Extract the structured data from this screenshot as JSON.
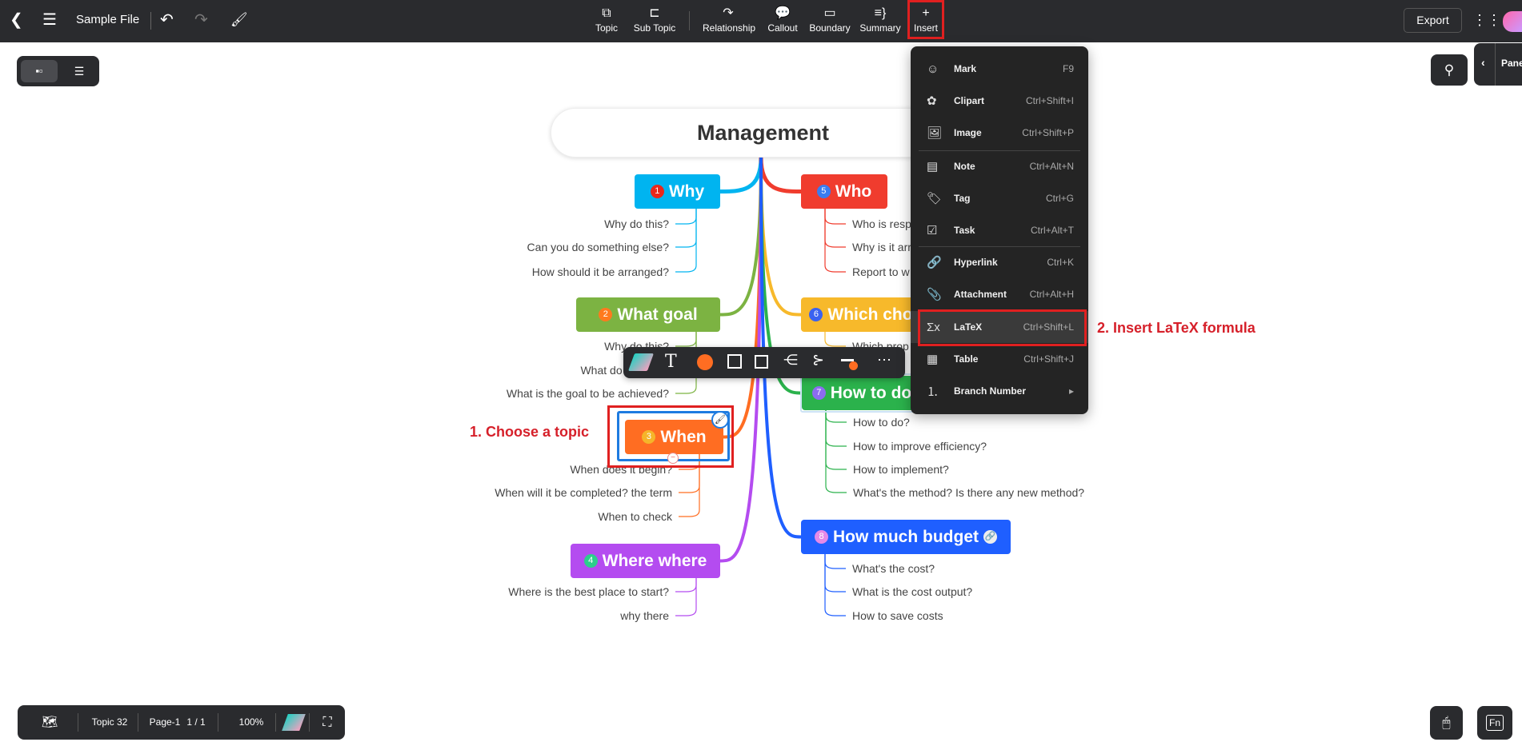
{
  "topbar": {
    "title": "Sample File",
    "tools": [
      {
        "label": "Topic",
        "icon": "topic-icon",
        "g": "⧉"
      },
      {
        "label": "Sub Topic",
        "icon": "subtopic-icon",
        "g": "⊏"
      },
      {
        "label": "Relationship",
        "icon": "relationship-icon",
        "g": "↷"
      },
      {
        "label": "Callout",
        "icon": "callout-icon",
        "g": "💬"
      },
      {
        "label": "Boundary",
        "icon": "boundary-icon",
        "g": "▭"
      },
      {
        "label": "Summary",
        "icon": "summary-icon",
        "g": "≡}"
      },
      {
        "label": "Insert",
        "icon": "plus-icon",
        "g": "+"
      }
    ],
    "export_label": "Export"
  },
  "panel": {
    "label": "Pane"
  },
  "mindmap": {
    "root": "Management",
    "branches": [
      {
        "num": "1",
        "label": "Why",
        "color": "#00b4f0",
        "numColor": "#e8271c",
        "leaves": [
          "Why do this?",
          "Can you do something else?",
          "How should it be arranged?"
        ]
      },
      {
        "num": "2",
        "label": "What goal",
        "color": "#7cb342",
        "numColor": "#ff7a1e",
        "leaves": [
          "Why do this?",
          "What do I need to",
          "What is the goal to be achieved?"
        ]
      },
      {
        "num": "3",
        "label": "When",
        "color": "#ff6d22",
        "numColor": "#f5b52a",
        "leaves": [
          "When does it begin?",
          "When will it be completed? the term",
          "When to check"
        ]
      },
      {
        "num": "4",
        "label": "Where where",
        "color": "#b44cf0",
        "numColor": "#2ccf8c",
        "leaves": [
          "Where is the best place to start?",
          "why there"
        ]
      },
      {
        "num": "5",
        "label": "Who",
        "color": "#f03c2e",
        "numColor": "#3a7cf0",
        "leaves": [
          "Who is resp",
          "Why is it arr",
          "Report to w"
        ]
      },
      {
        "num": "6",
        "label": "Which cho",
        "color": "#f7b92b",
        "numColor": "#3a62f0",
        "leaves": [
          "Which prop"
        ]
      },
      {
        "num": "7",
        "label": "How to do",
        "color": "#2bb24c",
        "numColor": "#8c6cf0",
        "leaves": [
          "How to do?",
          "How to improve efficiency?",
          "How to implement?",
          "What's the method? Is there any new method?"
        ]
      },
      {
        "num": "8",
        "label": "How much budget",
        "color": "#1f5fff",
        "numColor": "#e58ae8",
        "leaves": [
          "What's the cost?",
          "What is the cost output?",
          "How to save costs"
        ]
      }
    ]
  },
  "insert_menu": [
    {
      "label": "Mark",
      "shortcut": "F9",
      "icon": "mark-icon",
      "g": "☺"
    },
    {
      "label": "Clipart",
      "shortcut": "Ctrl+Shift+I",
      "icon": "clipart-icon",
      "g": "✿"
    },
    {
      "label": "Image",
      "shortcut": "Ctrl+Shift+P",
      "icon": "image-icon",
      "g": "🖼"
    },
    {
      "label": "Note",
      "shortcut": "Ctrl+Alt+N",
      "icon": "note-icon",
      "g": "▤"
    },
    {
      "label": "Tag",
      "shortcut": "Ctrl+G",
      "icon": "tag-icon",
      "g": "🏷"
    },
    {
      "label": "Task",
      "shortcut": "Ctrl+Alt+T",
      "icon": "task-icon",
      "g": "☑"
    },
    {
      "label": "Hyperlink",
      "shortcut": "Ctrl+K",
      "icon": "link-icon",
      "g": "🔗"
    },
    {
      "label": "Attachment",
      "shortcut": "Ctrl+Alt+H",
      "icon": "paperclip-icon",
      "g": "📎"
    },
    {
      "label": "LaTeX",
      "shortcut": "Ctrl+Shift+L",
      "icon": "sigma-icon",
      "g": "Σx"
    },
    {
      "label": "Table",
      "shortcut": "Ctrl+Shift+J",
      "icon": "table-icon",
      "g": "▦"
    },
    {
      "label": "Branch Number",
      "shortcut": "▸",
      "icon": "numbered-list-icon",
      "g": "⒈"
    }
  ],
  "annotations": {
    "step1": "1. Choose a topic",
    "step2": "2. Insert LaTeX formula"
  },
  "bottombar": {
    "topic_count": "Topic 32",
    "page": "Page-1",
    "page_count": "1 / 1",
    "zoom": "100%"
  },
  "colors": {
    "accent_red": "#e02020",
    "toolbar_bg": "#2a2b2e",
    "selection": "#1e7be0"
  }
}
